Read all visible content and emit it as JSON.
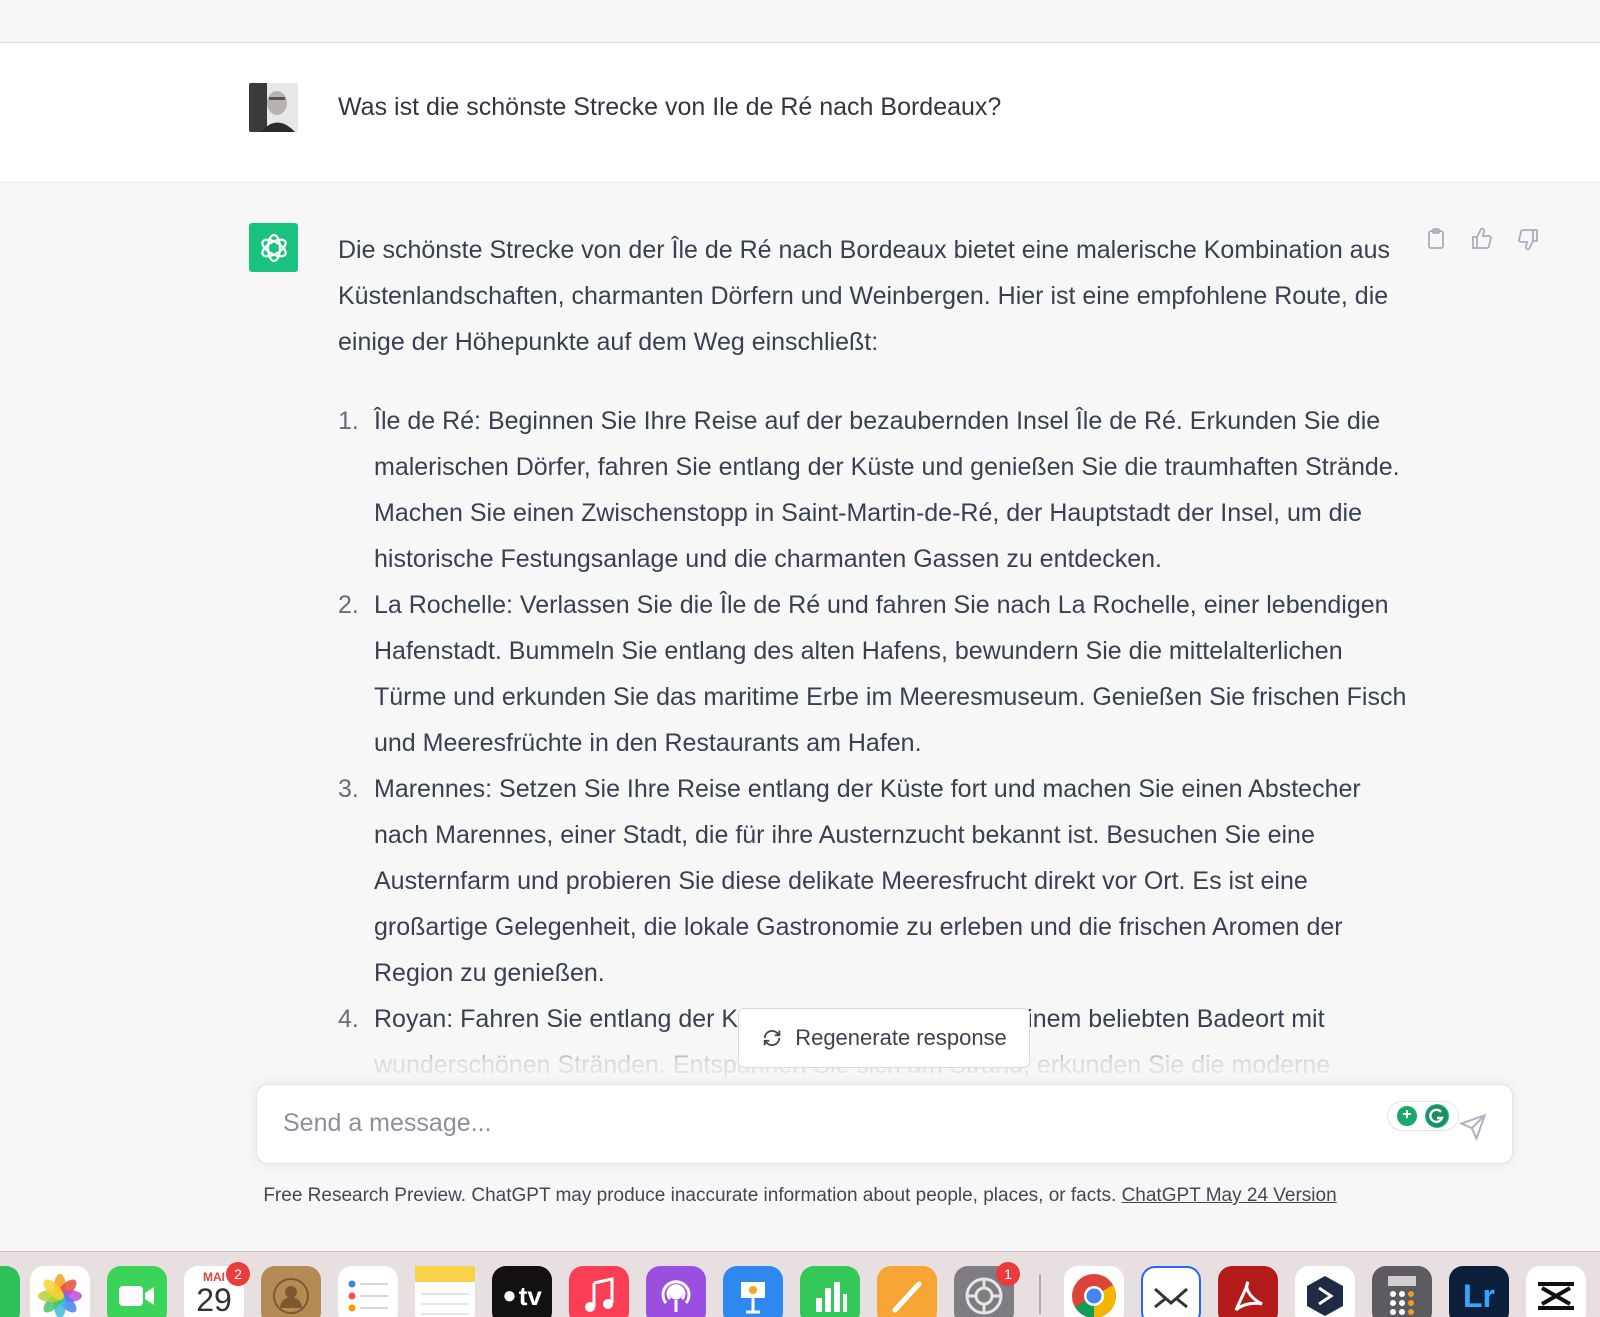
{
  "user_message": "Was ist die schönste Strecke von Ile de Ré nach Bordeaux?",
  "assistant": {
    "intro": "Die schönste Strecke von der Île de Ré nach Bordeaux bietet eine malerische Kombination aus Küstenlandschaften, charmanten Dörfern und Weinbergen. Hier ist eine empfohlene Route, die einige der Höhepunkte auf dem Weg einschließt:",
    "items": [
      {
        "num": "1.",
        "text": "Île de Ré: Beginnen Sie Ihre Reise auf der bezaubernden Insel Île de Ré. Erkunden Sie die malerischen Dörfer, fahren Sie entlang der Küste und genießen Sie die traumhaften Strände. Machen Sie einen Zwischenstopp in Saint-Martin-de-Ré, der Hauptstadt der Insel, um die historische Festungsanlage und die charmanten Gassen zu entdecken."
      },
      {
        "num": "2.",
        "text": "La Rochelle: Verlassen Sie die Île de Ré und fahren Sie nach La Rochelle, einer lebendigen Hafenstadt. Bummeln Sie entlang des alten Hafens, bewundern Sie die mittelalterlichen Türme und erkunden Sie das maritime Erbe im Meeresmuseum. Genießen Sie frischen Fisch und Meeresfrüchte in den Restaurants am Hafen."
      },
      {
        "num": "3.",
        "text": "Marennes: Setzen Sie Ihre Reise entlang der Küste fort und machen Sie einen Abstecher nach Marennes, einer Stadt, die für ihre Austernzucht bekannt ist. Besuchen Sie eine Austernfarm und probieren Sie diese delikate Meeresfrucht direkt vor Ort. Es ist eine großartige Gelegenheit, die lokale Gastronomie zu erleben und die frischen Aromen der Region zu genießen."
      },
      {
        "num": "4.",
        "text": "Royan: Fahren Sie entlang der Küste weiter nach Royan, einem beliebten Badeort mit wunderschönen Stränden. Entspannen Sie sich am Strand, erkunden Sie die moderne"
      }
    ]
  },
  "regenerate_label": "Regenerate response",
  "composer": {
    "placeholder": "Send a message..."
  },
  "footer": {
    "text": "Free Research Preview. ChatGPT may produce inaccurate information about people, places, or facts. ",
    "link": "ChatGPT May 24 Version"
  },
  "dock": {
    "calendar_month": "MAI",
    "calendar_day": "29",
    "calendar_badge": "2",
    "settings_badge": "1",
    "tv_label": "tv",
    "lr_label": "Lr"
  },
  "colors": {
    "accent": "#19c37d",
    "background": "#f7f7f8",
    "text": "#374151"
  }
}
